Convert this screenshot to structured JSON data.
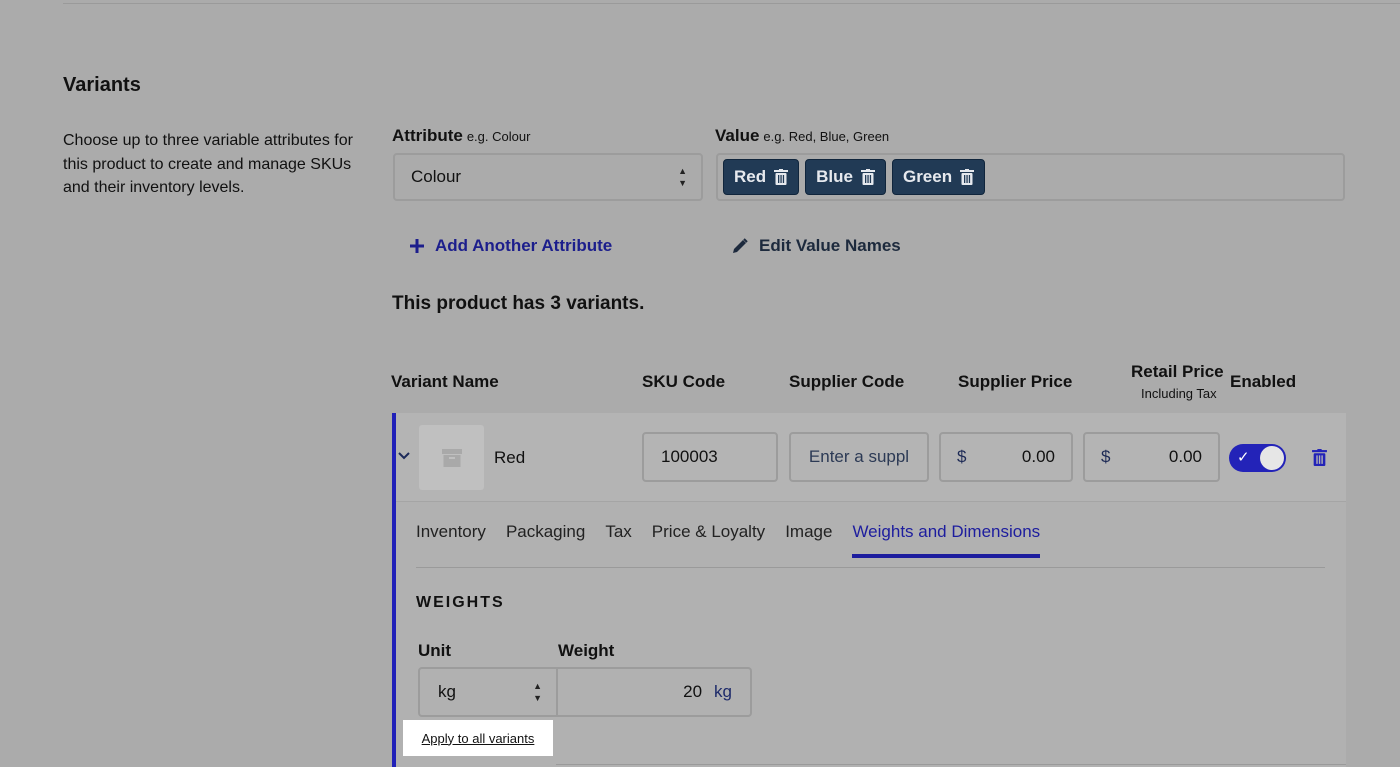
{
  "section": {
    "title": "Variants",
    "description": "Choose up to three variable attributes for this product to create and manage SKUs and their inventory levels."
  },
  "attribute": {
    "label": "Attribute",
    "hint": "e.g. Colour",
    "selected": "Colour"
  },
  "value": {
    "label": "Value",
    "hint": "e.g. Red, Blue, Green",
    "chips": [
      "Red",
      "Blue",
      "Green"
    ]
  },
  "actions": {
    "add_attribute": "Add Another Attribute",
    "edit_values": "Edit Value Names"
  },
  "variants_summary": "This product has 3 variants.",
  "table": {
    "headers": {
      "variant_name": "Variant Name",
      "sku_code": "SKU Code",
      "supplier_code": "Supplier Code",
      "supplier_price": "Supplier Price",
      "retail_price": "Retail Price",
      "retail_price_sub": "Including Tax",
      "enabled": "Enabled"
    }
  },
  "variant": {
    "name": "Red",
    "sku": "100003",
    "supplier_code_placeholder": "Enter a suppl",
    "supplier_price_currency": "$",
    "supplier_price": "0.00",
    "retail_price_currency": "$",
    "retail_price": "0.00",
    "enabled": true
  },
  "tabs": [
    "Inventory",
    "Packaging",
    "Tax",
    "Price & Loyalty",
    "Image",
    "Weights and Dimensions"
  ],
  "active_tab": "Weights and Dimensions",
  "weights": {
    "title": "WEIGHTS",
    "unit_label": "Unit",
    "weight_label": "Weight",
    "unit_selected": "kg",
    "weight_value": "20",
    "weight_unit": "kg",
    "apply_all": "Apply to all variants"
  },
  "colors": {
    "accent": "#1d1d9e",
    "chip_bg": "#213a55",
    "background": "#ababab"
  }
}
